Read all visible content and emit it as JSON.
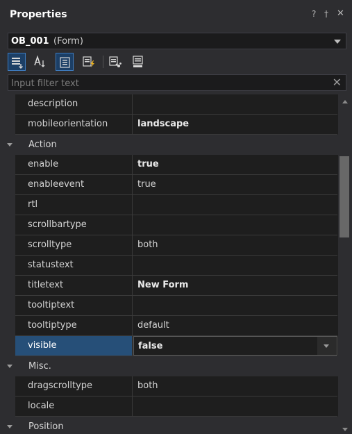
{
  "panel": {
    "title": "Properties",
    "help_glyph": "?",
    "pin_glyph": "†",
    "close_glyph": "✕"
  },
  "object_selector": {
    "name": "OB_001",
    "type": "(Form)"
  },
  "toolbar": {
    "buttons": [
      {
        "icon": "categorized-view-icon",
        "active": true
      },
      {
        "icon": "alphabetical-sort-icon",
        "active": false
      },
      {
        "icon": "properties-view-icon",
        "active": true
      },
      {
        "icon": "events-view-icon",
        "active": false
      },
      {
        "icon": "bind-icon",
        "active": false
      },
      {
        "icon": "init-icon",
        "active": false
      }
    ]
  },
  "filter": {
    "placeholder": "Input filter text",
    "value": "",
    "clear_glyph": "✕"
  },
  "grid": {
    "rows": [
      {
        "kind": "prop",
        "name": "description",
        "value": "",
        "bold": false
      },
      {
        "kind": "prop",
        "name": "mobileorientation",
        "value": "landscape",
        "bold": true
      },
      {
        "kind": "category",
        "label": "Action"
      },
      {
        "kind": "prop",
        "name": "enable",
        "value": "true",
        "bold": true
      },
      {
        "kind": "prop",
        "name": "enableevent",
        "value": "true",
        "bold": false
      },
      {
        "kind": "prop",
        "name": "rtl",
        "value": "",
        "bold": false
      },
      {
        "kind": "prop",
        "name": "scrollbartype",
        "value": "",
        "bold": false
      },
      {
        "kind": "prop",
        "name": "scrolltype",
        "value": "both",
        "bold": false
      },
      {
        "kind": "prop",
        "name": "statustext",
        "value": "",
        "bold": false
      },
      {
        "kind": "prop",
        "name": "titletext",
        "value": "New Form",
        "bold": true
      },
      {
        "kind": "prop",
        "name": "tooltiptext",
        "value": "",
        "bold": false
      },
      {
        "kind": "prop",
        "name": "tooltiptype",
        "value": "default",
        "bold": false
      },
      {
        "kind": "prop",
        "name": "visible",
        "value": "false",
        "bold": true,
        "selected": true
      },
      {
        "kind": "category",
        "label": "Misc."
      },
      {
        "kind": "prop",
        "name": "dragscrolltype",
        "value": "both",
        "bold": false
      },
      {
        "kind": "prop",
        "name": "locale",
        "value": "",
        "bold": false
      },
      {
        "kind": "category",
        "label": "Position"
      }
    ]
  },
  "colors": {
    "background": "#2d2d30",
    "grid": "#1e1e1e",
    "selection": "#264f78",
    "accent": "#3e7cc0"
  }
}
